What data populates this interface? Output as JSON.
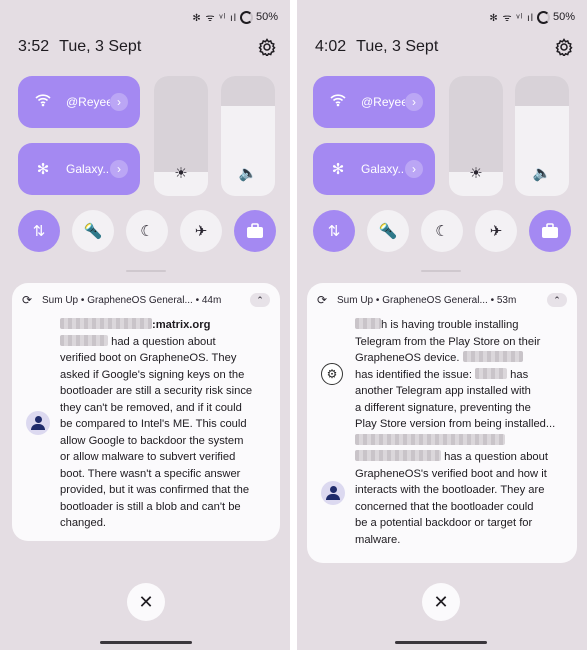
{
  "status_bar": {
    "icons": "✻ ᯤ ᵛˡ ıl",
    "battery": "50%"
  },
  "colors": {
    "accent": "#a489f2",
    "panel_bg": "#e4dde3",
    "card_bg": "#fbfafc"
  },
  "left": {
    "time": "3:52",
    "date": "Tue, 3 Sept",
    "tiles": [
      {
        "icon": "wifi-icon",
        "label": "@Reyee..."
      },
      {
        "icon": "bluetooth-icon",
        "label": "Galaxy..."
      }
    ],
    "brightness_level": 0.2,
    "volume_level": 0.75,
    "quick_toggles": [
      {
        "icon": "data-transfer-icon",
        "on": true
      },
      {
        "icon": "flashlight-icon",
        "on": false
      },
      {
        "icon": "moon-icon",
        "on": false
      },
      {
        "icon": "airplane-icon",
        "on": false
      },
      {
        "icon": "briefcase-icon",
        "on": true
      }
    ],
    "notification": {
      "app": "Sum Up",
      "channel": "GrapheneOS General...",
      "age": "44m",
      "lines": [
        ":matrix.org",
        " had a question about",
        "verified boot on GrapheneOS. They",
        "asked if Google's signing keys on the",
        "bootloader are still a security risk since",
        "they can't be removed, and if it could",
        "be compared to Intel's ME. This could",
        "allow Google to backdoor the system",
        "or allow malware to subvert verified",
        "boot. There wasn't a specific answer",
        "provided, but it was confirmed that the",
        "bootloader is still a blob and can't be",
        "changed."
      ]
    }
  },
  "right": {
    "time": "4:02",
    "date": "Tue, 3 Sept",
    "tiles": [
      {
        "icon": "wifi-icon",
        "label": "@Reyee..."
      },
      {
        "icon": "bluetooth-icon",
        "label": "Galaxy..."
      }
    ],
    "brightness_level": 0.2,
    "volume_level": 0.75,
    "notification": {
      "app": "Sum Up",
      "channel": "GrapheneOS General...",
      "age": "53m",
      "lines": [
        "h is having trouble installing",
        "Telegram from the Play Store on their",
        "GrapheneOS device.",
        "has identified the issue:",
        "has",
        "another Telegram app installed with",
        "a different signature, preventing the",
        "Play Store version from being installed...",
        "has a question about",
        "GrapheneOS's verified boot and how it",
        "interacts with the bootloader.  They are",
        "concerned that the bootloader could",
        "be a potential backdoor or target for",
        "malware."
      ]
    }
  },
  "close_symbol": "✕"
}
